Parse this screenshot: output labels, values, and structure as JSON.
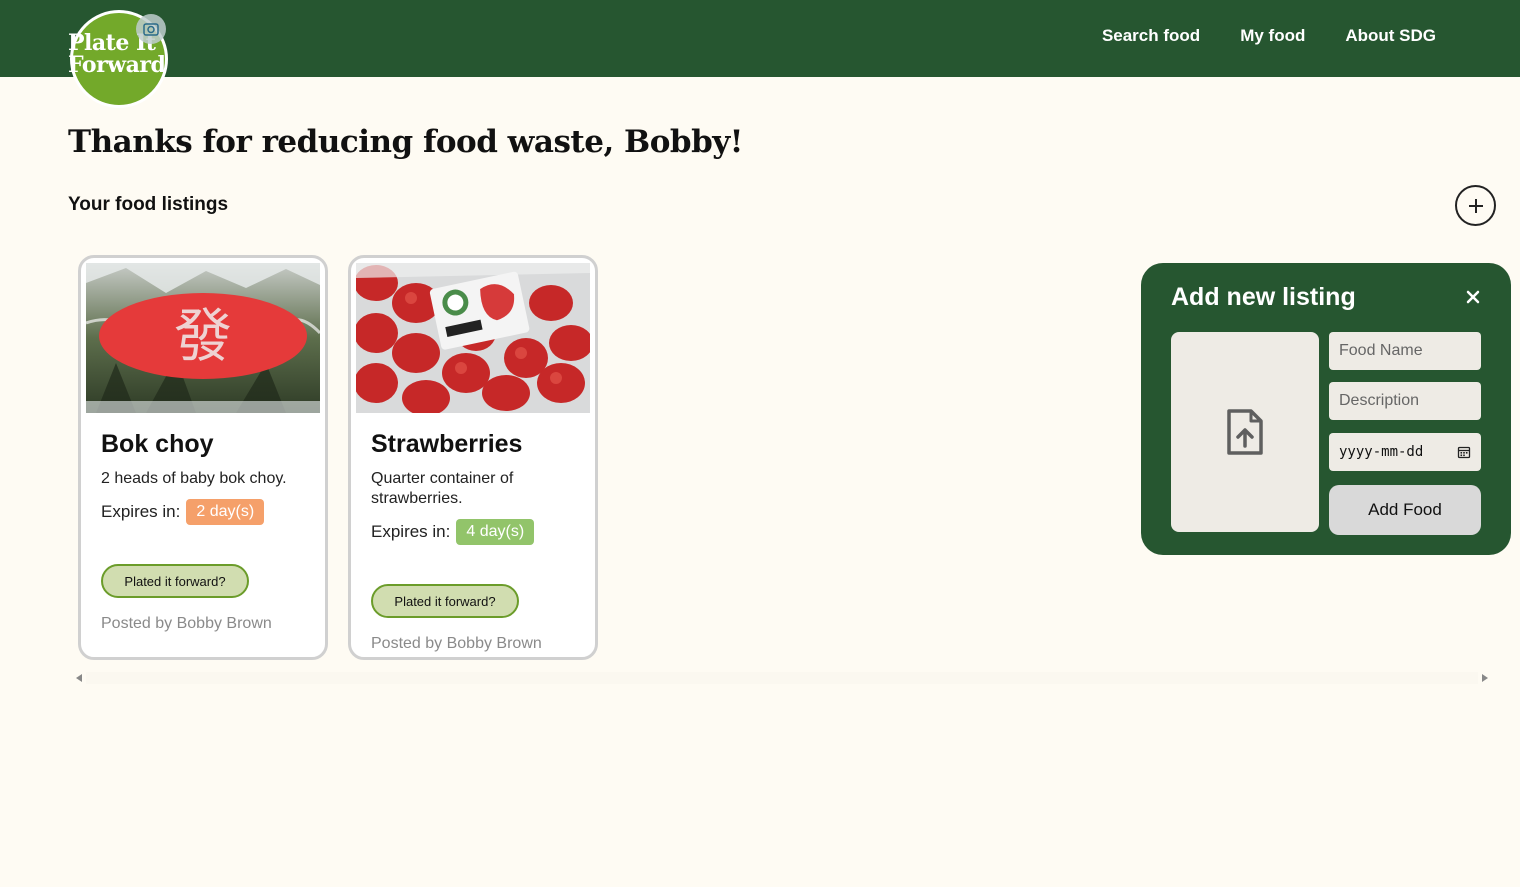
{
  "header": {
    "logo_line1": "Plate It",
    "logo_line2": "Forward",
    "nav": [
      "Search food",
      "My food",
      "About SDG"
    ]
  },
  "main": {
    "heading": "Thanks for reducing food waste, Bobby!",
    "subheading": "Your food listings"
  },
  "listings": [
    {
      "title": "Bok choy",
      "description": "2 heads of baby bok choy.",
      "expires_label": "Expires in:",
      "expires_value": "2 day(s)",
      "badge_color": "#f5a06a",
      "button_label": "Plated it forward?",
      "posted_by": "Posted by Bobby Brown",
      "image_icon": "bok-choy-photo"
    },
    {
      "title": "Strawberries",
      "description": "Quarter container of strawberries.",
      "expires_label": "Expires in:",
      "expires_value": "4 day(s)",
      "badge_color": "#92c46a",
      "button_label": "Plated it forward?",
      "posted_by": "Posted by Bobby Brown",
      "image_icon": "strawberries-photo"
    }
  ],
  "panel": {
    "title": "Add new listing",
    "close_icon": "close-icon",
    "upload_icon": "file-upload-icon",
    "food_name_placeholder": "Food Name",
    "description_placeholder": "Description",
    "date_placeholder": "yyyy-mm-dd",
    "submit_label": "Add Food"
  },
  "colors": {
    "header_bg": "#265630",
    "brand_green": "#73a92a",
    "page_bg": "#fefbf3"
  }
}
